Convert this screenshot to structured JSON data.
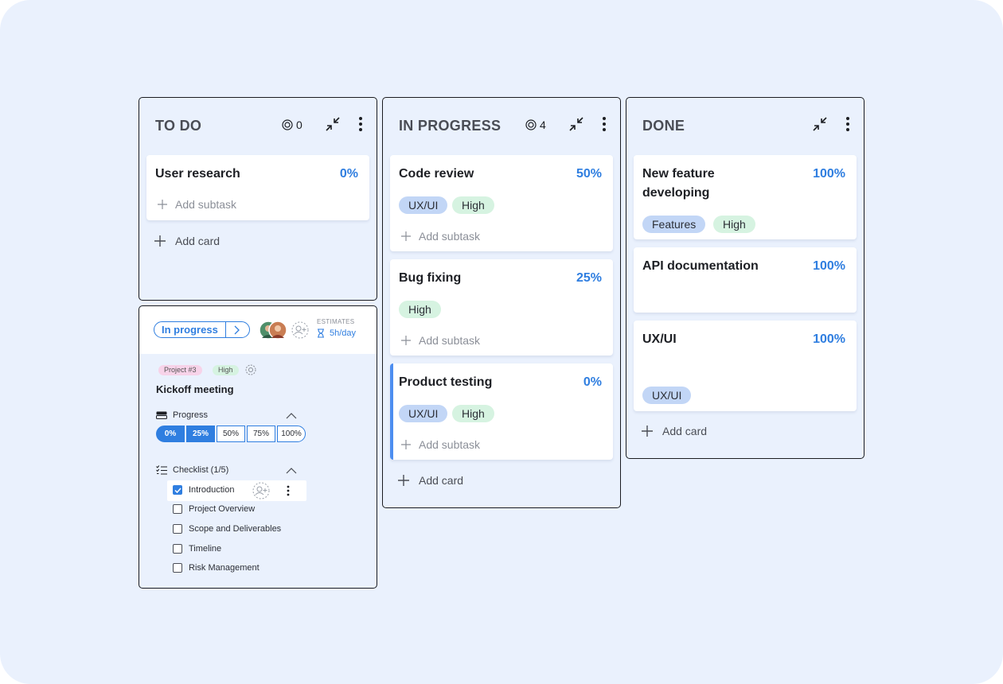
{
  "columns": [
    {
      "title": "TO DO",
      "count": "0",
      "add_card": "Add card",
      "cards": [
        {
          "title": "User research",
          "percent": "0%",
          "add_subtask": "Add subtask"
        }
      ]
    },
    {
      "title": "IN PROGRESS",
      "count": "4",
      "add_card": "Add card",
      "cards": [
        {
          "title": "Code review",
          "percent": "50%",
          "tags": [
            "UX/UI",
            "High"
          ],
          "add_subtask": "Add subtask"
        },
        {
          "title": "Bug fixing",
          "percent": "25%",
          "tags": [
            "High"
          ],
          "add_subtask": "Add subtask"
        },
        {
          "title": "Product testing",
          "percent": "0%",
          "tags": [
            "UX/UI",
            "High"
          ],
          "add_subtask": "Add subtask"
        }
      ]
    },
    {
      "title": "DONE",
      "add_card": "Add card",
      "cards": [
        {
          "title_line1": "New feature",
          "title_line2": "developing",
          "percent": "100%",
          "tags": [
            "Features",
            "High"
          ]
        },
        {
          "title": "API documentation",
          "percent": "100%"
        },
        {
          "title": "UX/UI",
          "percent": "100%",
          "tags": [
            "UX/UI"
          ]
        }
      ]
    }
  ],
  "detail": {
    "status": "In progress",
    "estimates_label": "ESTIMATES",
    "estimate_value": "5h/day",
    "project_tag": "Project #3",
    "priority_tag": "High",
    "task_title": "Kickoff meeting",
    "progress_label": "Progress",
    "progress_options": [
      "0%",
      "25%",
      "50%",
      "75%",
      "100%"
    ],
    "progress_value": 0.25,
    "checklist_label": "Checklist (1/5)",
    "checklist": [
      {
        "label": "Introduction",
        "checked": true
      },
      {
        "label": "Project Overview",
        "checked": false
      },
      {
        "label": "Scope and Deliverables",
        "checked": false
      },
      {
        "label": "Timeline",
        "checked": false
      },
      {
        "label": "Risk Management",
        "checked": false
      }
    ]
  },
  "colors": {
    "accent": "#2f7ee0",
    "background": "#eaf1fd",
    "tag_blue": "#c2d6f6",
    "tag_green": "#d6f3e1",
    "tag_pink": "#f7d3e9"
  },
  "icons": [
    "target-icon",
    "collapse-icon",
    "more-vertical-icon",
    "plus-icon",
    "chevron-right-icon",
    "add-user-icon",
    "hourglass-icon",
    "toggle-icon",
    "chevron-up-icon",
    "checklist-icon",
    "check-icon"
  ]
}
